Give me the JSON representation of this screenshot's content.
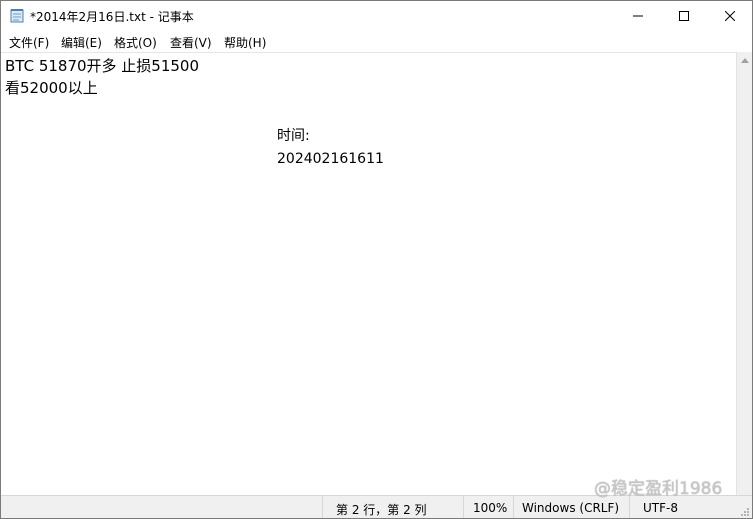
{
  "window": {
    "title": "*2014年2月16日.txt - 记事本"
  },
  "menu": {
    "items": [
      "文件(F)",
      "编辑(E)",
      "格式(O)",
      "查看(V)",
      "帮助(H)"
    ]
  },
  "editor": {
    "lines": [
      "BTC 51870开多 止损51500",
      "看52000以上",
      "时间:",
      "202402161611"
    ]
  },
  "status": {
    "position": "第 2 行，第 2 列",
    "zoom": "100%",
    "line_ending": "Windows (CRLF)",
    "encoding": "UTF-8"
  },
  "watermark": {
    "text": "@稳定盈利1986"
  }
}
